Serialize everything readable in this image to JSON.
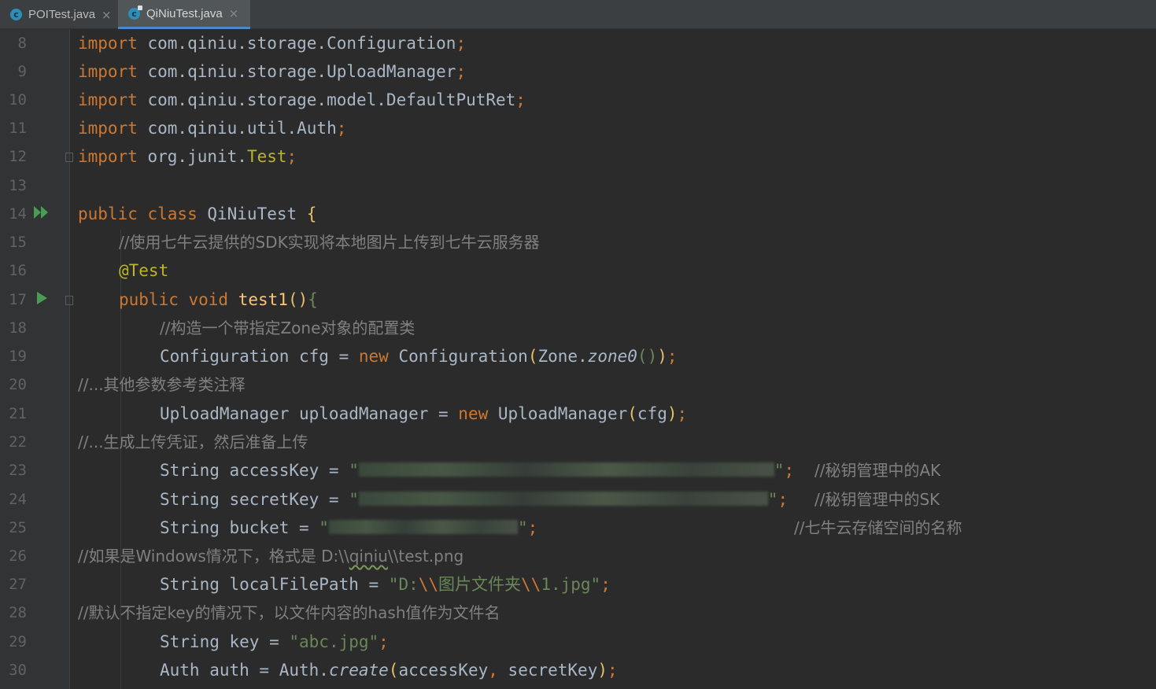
{
  "tabs": [
    {
      "label": "POITest.java",
      "icon": "java-class-icon",
      "active": false
    },
    {
      "label": "QiNiuTest.java",
      "icon": "java-class-icon",
      "active": true
    }
  ],
  "lines": {
    "l8": {
      "num": "8",
      "a": "import",
      "b": " com.qiniu.storage.Configuration",
      "c": ";"
    },
    "l9": {
      "num": "9",
      "a": "import",
      "b": " com.qiniu.storage.UploadManager",
      "c": ";"
    },
    "l10": {
      "num": "10",
      "a": "import",
      "b": " com.qiniu.storage.model.DefaultPutRet",
      "c": ";"
    },
    "l11": {
      "num": "11",
      "a": "import",
      "b": " com.qiniu.util.Auth",
      "c": ";"
    },
    "l12": {
      "num": "12",
      "a": "import",
      "b": " org.junit.",
      "d": "Test",
      "c": ";"
    },
    "l13": {
      "num": "13"
    },
    "l14": {
      "num": "14",
      "a": "public class",
      "b": " QiNiuTest ",
      "c": "{"
    },
    "l15": {
      "num": "15",
      "a": "//使用七牛云提供的SDK实现将本地图片上传到七牛云服务器"
    },
    "l16": {
      "num": "16",
      "a": "@Test"
    },
    "l17": {
      "num": "17",
      "a": "public void",
      "b": " ",
      "d": "test1",
      "e": "()",
      "c": "{"
    },
    "l18": {
      "num": "18",
      "a": "//构造一个带指定Zone对象的配置类"
    },
    "l19": {
      "num": "19",
      "b": "Configuration cfg = ",
      "a": "new",
      "c": " Configuration",
      "p1": "(",
      "d": "Zone.",
      "e": "zone0",
      "p2": "()",
      "p3": ")",
      "f": ";"
    },
    "l20": {
      "num": "20",
      "a": "//...其他参数参考类注释"
    },
    "l21": {
      "num": "21",
      "b": "UploadManager uploadManager = ",
      "a": "new",
      "c": " UploadManager",
      "p1": "(",
      "d": "cfg",
      "p2": ")",
      "f": ";"
    },
    "l22": {
      "num": "22",
      "a": "//...生成上传凭证，然后准备上传"
    },
    "l23": {
      "num": "23",
      "b": "String accessKey = ",
      "q1": "\"",
      "q2": "\"",
      "f": ";",
      "cmt": "//秘钥管理中的AK"
    },
    "l24": {
      "num": "24",
      "b": "String secretKey = ",
      "q1": "\"",
      "q2": "\"",
      "f": ";",
      "cmt": "//秘钥管理中的SK"
    },
    "l25": {
      "num": "25",
      "b": "String bucket = ",
      "q1": "\"",
      "q2": "\"",
      "f": ";",
      "cmt": "//七牛云存储空间的名称"
    },
    "l26": {
      "num": "26",
      "a": "//如果是Windows情况下，格式是 D:\\\\",
      "s": "qiniu",
      "c": "\\\\test.png"
    },
    "l27": {
      "num": "27",
      "b": "String localFilePath = ",
      "s1": "\"D:",
      "a": "\\\\",
      "s2": "图片文件夹",
      "c": "\\\\",
      "s3": "1.jpg\"",
      "f": ";"
    },
    "l28": {
      "num": "28",
      "a": "//默认不指定key的情况下，以文件内容的hash值作为文件名"
    },
    "l29": {
      "num": "29",
      "b": "String key = ",
      "s1": "\"abc.jpg\"",
      "f": ";"
    },
    "l30": {
      "num": "30",
      "b": "Auth auth = Auth.",
      "e": "create",
      "p1": "(",
      "d": "accessKey",
      "k": ", ",
      "d2": "secretKey",
      "p2": ")",
      "f": ";"
    }
  }
}
